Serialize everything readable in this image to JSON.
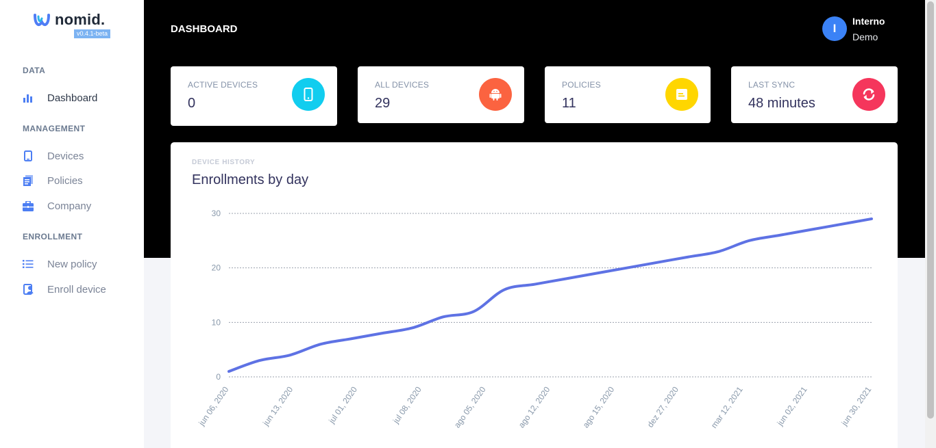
{
  "brand": {
    "name": "nomid.",
    "version": "v0.4.1-beta"
  },
  "sidebar": {
    "sections": [
      {
        "heading": "DATA",
        "items": [
          {
            "label": "Dashboard",
            "icon": "bar-chart-icon",
            "active": true
          }
        ]
      },
      {
        "heading": "MANAGEMENT",
        "items": [
          {
            "label": "Devices",
            "icon": "tablet-icon"
          },
          {
            "label": "Policies",
            "icon": "document-icon"
          },
          {
            "label": "Company",
            "icon": "briefcase-icon"
          }
        ]
      },
      {
        "heading": "ENROLLMENT",
        "items": [
          {
            "label": "New policy",
            "icon": "list-icon"
          },
          {
            "label": "Enroll device",
            "icon": "badge-icon"
          }
        ]
      }
    ]
  },
  "header": {
    "title": "DASHBOARD",
    "user": {
      "initial": "I",
      "name": "Interno",
      "subtitle": "Demo"
    }
  },
  "stats": [
    {
      "label": "ACTIVE DEVICES",
      "value": "0",
      "icon": "phone-icon",
      "color": "#11cdef"
    },
    {
      "label": "ALL DEVICES",
      "value": "29",
      "icon": "android-icon",
      "color": "#fb6340"
    },
    {
      "label": "POLICIES",
      "value": "11",
      "icon": "note-icon",
      "color": "#ffd600"
    },
    {
      "label": "LAST SYNC",
      "value": "48 minutes",
      "icon": "sync-icon",
      "color": "#f5365c"
    }
  ],
  "panel": {
    "overline": "DEVICE HISTORY",
    "title": "Enrollments by day"
  },
  "colors": {
    "accent": "#5e72e4",
    "header_bg": "#000000",
    "page_bg": "#f4f5f9"
  },
  "chart_data": {
    "type": "line",
    "title": "Enrollments by day",
    "xlabel": "",
    "ylabel": "",
    "ylim": [
      0,
      30
    ],
    "yticks": [
      0,
      10,
      20,
      30
    ],
    "grid": true,
    "x": [
      "jun 06, 2020",
      "jun 13, 2020",
      "jul 01, 2020",
      "jul 08, 2020",
      "ago 05, 2020",
      "ago 12, 2020",
      "ago 15, 2020",
      "dez 27, 2020",
      "mar 12, 2021",
      "jun 02, 2021",
      "jun 30, 2021"
    ],
    "series": [
      {
        "values": [
          1,
          3,
          4,
          6,
          7,
          8,
          9,
          11,
          12,
          16,
          17,
          18,
          19,
          20,
          21,
          22,
          23,
          25,
          26,
          27,
          28,
          29
        ]
      }
    ]
  }
}
